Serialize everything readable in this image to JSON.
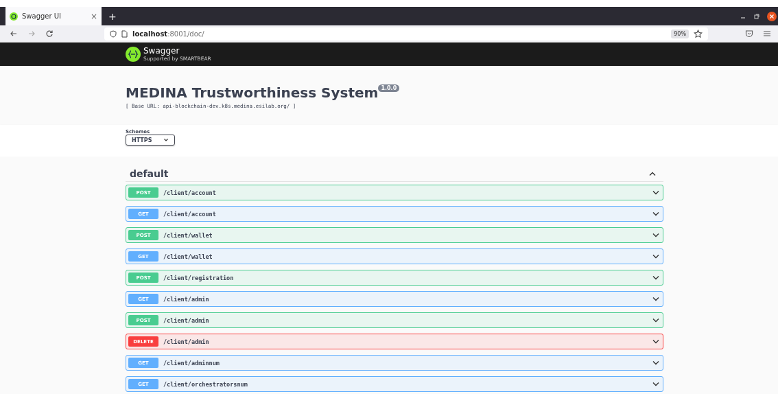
{
  "browser": {
    "tab": {
      "title": "Swagger UI",
      "close": "×",
      "selected": true
    },
    "new_tab": "+",
    "url": "**localhost**:8001/doc/",
    "zoom": "90%"
  },
  "header": {
    "logo": "Swagger",
    "tagline": "Supported by SMARTBEAR"
  },
  "info": {
    "title": "MEDINA Trustworthiness System",
    "version": "1.0.0",
    "base_url": "[ Base URL: api-blockchain-dev.k8s.medina.esilab.org/ ]"
  },
  "schemes": {
    "label": "Schemes",
    "value": "HTTPS"
  },
  "section": {
    "name": "default",
    "expanded": true,
    "operations": [
      {
        "method": "POST",
        "kind": "post",
        "path": "/client/account"
      },
      {
        "method": "GET",
        "kind": "get",
        "path": "/client/account"
      },
      {
        "method": "POST",
        "kind": "post",
        "path": "/client/wallet"
      },
      {
        "method": "GET",
        "kind": "get",
        "path": "/client/wallet"
      },
      {
        "method": "POST",
        "kind": "post",
        "path": "/client/registration"
      },
      {
        "method": "GET",
        "kind": "get",
        "path": "/client/admin"
      },
      {
        "method": "POST",
        "kind": "post",
        "path": "/client/admin"
      },
      {
        "method": "DELETE",
        "kind": "delete",
        "path": "/client/admin"
      },
      {
        "method": "GET",
        "kind": "get",
        "path": "/client/adminnum"
      },
      {
        "method": "GET",
        "kind": "get",
        "path": "/client/orchestratorsnum"
      }
    ]
  }
}
